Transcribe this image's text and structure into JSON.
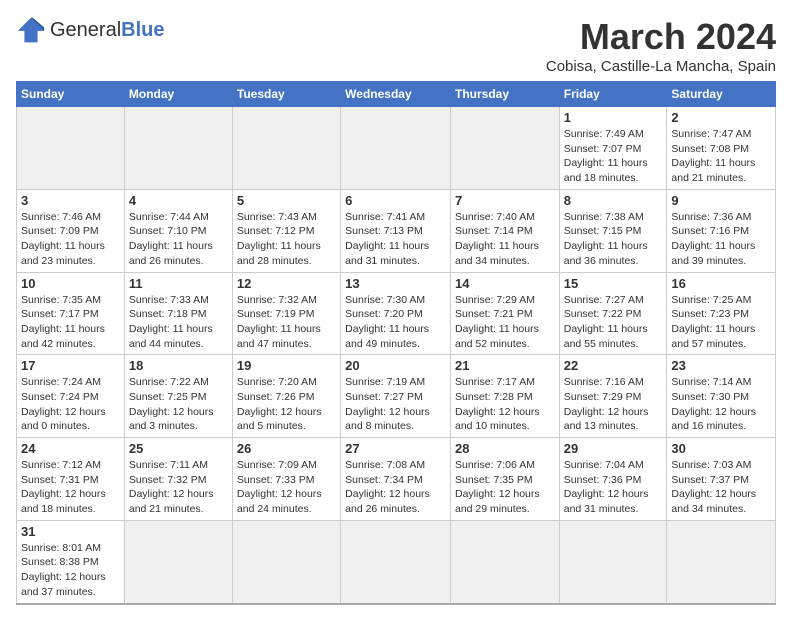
{
  "header": {
    "logo_text_general": "General",
    "logo_text_blue": "Blue",
    "month_title": "March 2024",
    "subtitle": "Cobisa, Castille-La Mancha, Spain"
  },
  "days_of_week": [
    "Sunday",
    "Monday",
    "Tuesday",
    "Wednesday",
    "Thursday",
    "Friday",
    "Saturday"
  ],
  "weeks": [
    [
      {
        "day": "",
        "info": ""
      },
      {
        "day": "",
        "info": ""
      },
      {
        "day": "",
        "info": ""
      },
      {
        "day": "",
        "info": ""
      },
      {
        "day": "",
        "info": ""
      },
      {
        "day": "1",
        "info": "Sunrise: 7:49 AM\nSunset: 7:07 PM\nDaylight: 11 hours and 18 minutes."
      },
      {
        "day": "2",
        "info": "Sunrise: 7:47 AM\nSunset: 7:08 PM\nDaylight: 11 hours and 21 minutes."
      }
    ],
    [
      {
        "day": "3",
        "info": "Sunrise: 7:46 AM\nSunset: 7:09 PM\nDaylight: 11 hours and 23 minutes."
      },
      {
        "day": "4",
        "info": "Sunrise: 7:44 AM\nSunset: 7:10 PM\nDaylight: 11 hours and 26 minutes."
      },
      {
        "day": "5",
        "info": "Sunrise: 7:43 AM\nSunset: 7:12 PM\nDaylight: 11 hours and 28 minutes."
      },
      {
        "day": "6",
        "info": "Sunrise: 7:41 AM\nSunset: 7:13 PM\nDaylight: 11 hours and 31 minutes."
      },
      {
        "day": "7",
        "info": "Sunrise: 7:40 AM\nSunset: 7:14 PM\nDaylight: 11 hours and 34 minutes."
      },
      {
        "day": "8",
        "info": "Sunrise: 7:38 AM\nSunset: 7:15 PM\nDaylight: 11 hours and 36 minutes."
      },
      {
        "day": "9",
        "info": "Sunrise: 7:36 AM\nSunset: 7:16 PM\nDaylight: 11 hours and 39 minutes."
      }
    ],
    [
      {
        "day": "10",
        "info": "Sunrise: 7:35 AM\nSunset: 7:17 PM\nDaylight: 11 hours and 42 minutes."
      },
      {
        "day": "11",
        "info": "Sunrise: 7:33 AM\nSunset: 7:18 PM\nDaylight: 11 hours and 44 minutes."
      },
      {
        "day": "12",
        "info": "Sunrise: 7:32 AM\nSunset: 7:19 PM\nDaylight: 11 hours and 47 minutes."
      },
      {
        "day": "13",
        "info": "Sunrise: 7:30 AM\nSunset: 7:20 PM\nDaylight: 11 hours and 49 minutes."
      },
      {
        "day": "14",
        "info": "Sunrise: 7:29 AM\nSunset: 7:21 PM\nDaylight: 11 hours and 52 minutes."
      },
      {
        "day": "15",
        "info": "Sunrise: 7:27 AM\nSunset: 7:22 PM\nDaylight: 11 hours and 55 minutes."
      },
      {
        "day": "16",
        "info": "Sunrise: 7:25 AM\nSunset: 7:23 PM\nDaylight: 11 hours and 57 minutes."
      }
    ],
    [
      {
        "day": "17",
        "info": "Sunrise: 7:24 AM\nSunset: 7:24 PM\nDaylight: 12 hours and 0 minutes."
      },
      {
        "day": "18",
        "info": "Sunrise: 7:22 AM\nSunset: 7:25 PM\nDaylight: 12 hours and 3 minutes."
      },
      {
        "day": "19",
        "info": "Sunrise: 7:20 AM\nSunset: 7:26 PM\nDaylight: 12 hours and 5 minutes."
      },
      {
        "day": "20",
        "info": "Sunrise: 7:19 AM\nSunset: 7:27 PM\nDaylight: 12 hours and 8 minutes."
      },
      {
        "day": "21",
        "info": "Sunrise: 7:17 AM\nSunset: 7:28 PM\nDaylight: 12 hours and 10 minutes."
      },
      {
        "day": "22",
        "info": "Sunrise: 7:16 AM\nSunset: 7:29 PM\nDaylight: 12 hours and 13 minutes."
      },
      {
        "day": "23",
        "info": "Sunrise: 7:14 AM\nSunset: 7:30 PM\nDaylight: 12 hours and 16 minutes."
      }
    ],
    [
      {
        "day": "24",
        "info": "Sunrise: 7:12 AM\nSunset: 7:31 PM\nDaylight: 12 hours and 18 minutes."
      },
      {
        "day": "25",
        "info": "Sunrise: 7:11 AM\nSunset: 7:32 PM\nDaylight: 12 hours and 21 minutes."
      },
      {
        "day": "26",
        "info": "Sunrise: 7:09 AM\nSunset: 7:33 PM\nDaylight: 12 hours and 24 minutes."
      },
      {
        "day": "27",
        "info": "Sunrise: 7:08 AM\nSunset: 7:34 PM\nDaylight: 12 hours and 26 minutes."
      },
      {
        "day": "28",
        "info": "Sunrise: 7:06 AM\nSunset: 7:35 PM\nDaylight: 12 hours and 29 minutes."
      },
      {
        "day": "29",
        "info": "Sunrise: 7:04 AM\nSunset: 7:36 PM\nDaylight: 12 hours and 31 minutes."
      },
      {
        "day": "30",
        "info": "Sunrise: 7:03 AM\nSunset: 7:37 PM\nDaylight: 12 hours and 34 minutes."
      }
    ],
    [
      {
        "day": "31",
        "info": "Sunrise: 8:01 AM\nSunset: 8:38 PM\nDaylight: 12 hours and 37 minutes."
      },
      {
        "day": "",
        "info": ""
      },
      {
        "day": "",
        "info": ""
      },
      {
        "day": "",
        "info": ""
      },
      {
        "day": "",
        "info": ""
      },
      {
        "day": "",
        "info": ""
      },
      {
        "day": "",
        "info": ""
      }
    ]
  ]
}
